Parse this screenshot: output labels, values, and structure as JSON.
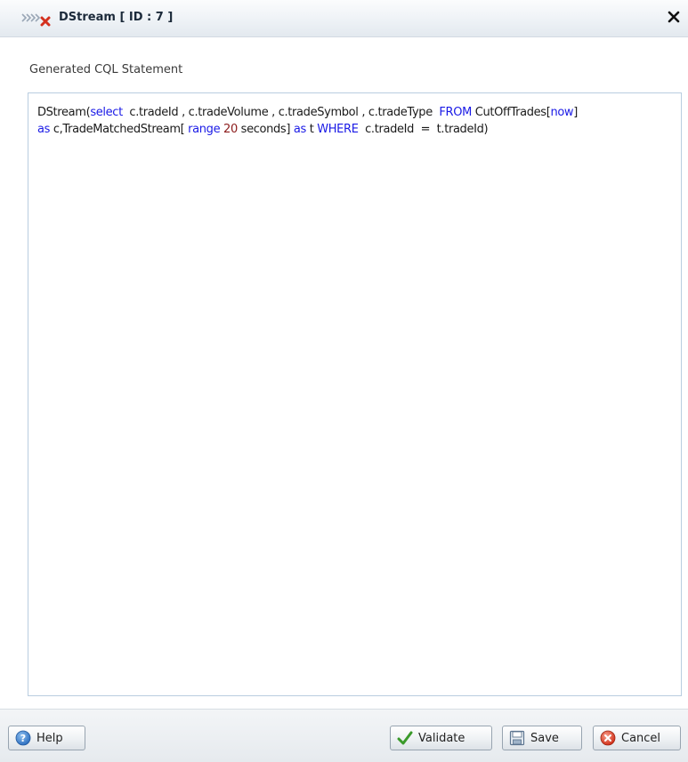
{
  "dialog": {
    "title": "DStream [ ID : 7 ]",
    "title_icon": "stream-operator-icon",
    "close_icon": "close-icon"
  },
  "section": {
    "label": "Generated CQL Statement"
  },
  "cql": {
    "line1": [
      {
        "t": "DStream(",
        "k": "plain"
      },
      {
        "t": "select",
        "k": "kw"
      },
      {
        "t": "  c.tradeId , c.tradeVolume , c.tradeSymbol , c.tradeType  ",
        "k": "plain"
      },
      {
        "t": "FROM",
        "k": "kw"
      },
      {
        "t": " CutOffTrades[",
        "k": "plain"
      },
      {
        "t": "now",
        "k": "kw"
      },
      {
        "t": "]",
        "k": "plain"
      }
    ],
    "line2": [
      {
        "t": "as",
        "k": "kw"
      },
      {
        "t": " c,TradeMatchedStream[ ",
        "k": "plain"
      },
      {
        "t": "range",
        "k": "kw"
      },
      {
        "t": " ",
        "k": "plain"
      },
      {
        "t": "20",
        "k": "num"
      },
      {
        "t": " seconds] ",
        "k": "plain"
      },
      {
        "t": "as",
        "k": "kw"
      },
      {
        "t": " t ",
        "k": "plain"
      },
      {
        "t": "WHERE",
        "k": "kw"
      },
      {
        "t": "  c.tradeId  =  t.tradeId)",
        "k": "plain"
      }
    ]
  },
  "buttons": {
    "help": "Help",
    "validate": "Validate",
    "save": "Save",
    "cancel": "Cancel"
  },
  "colors": {
    "keyword": "#1a1ae6",
    "number": "#8b1a1a",
    "text": "#1a1a1a"
  }
}
